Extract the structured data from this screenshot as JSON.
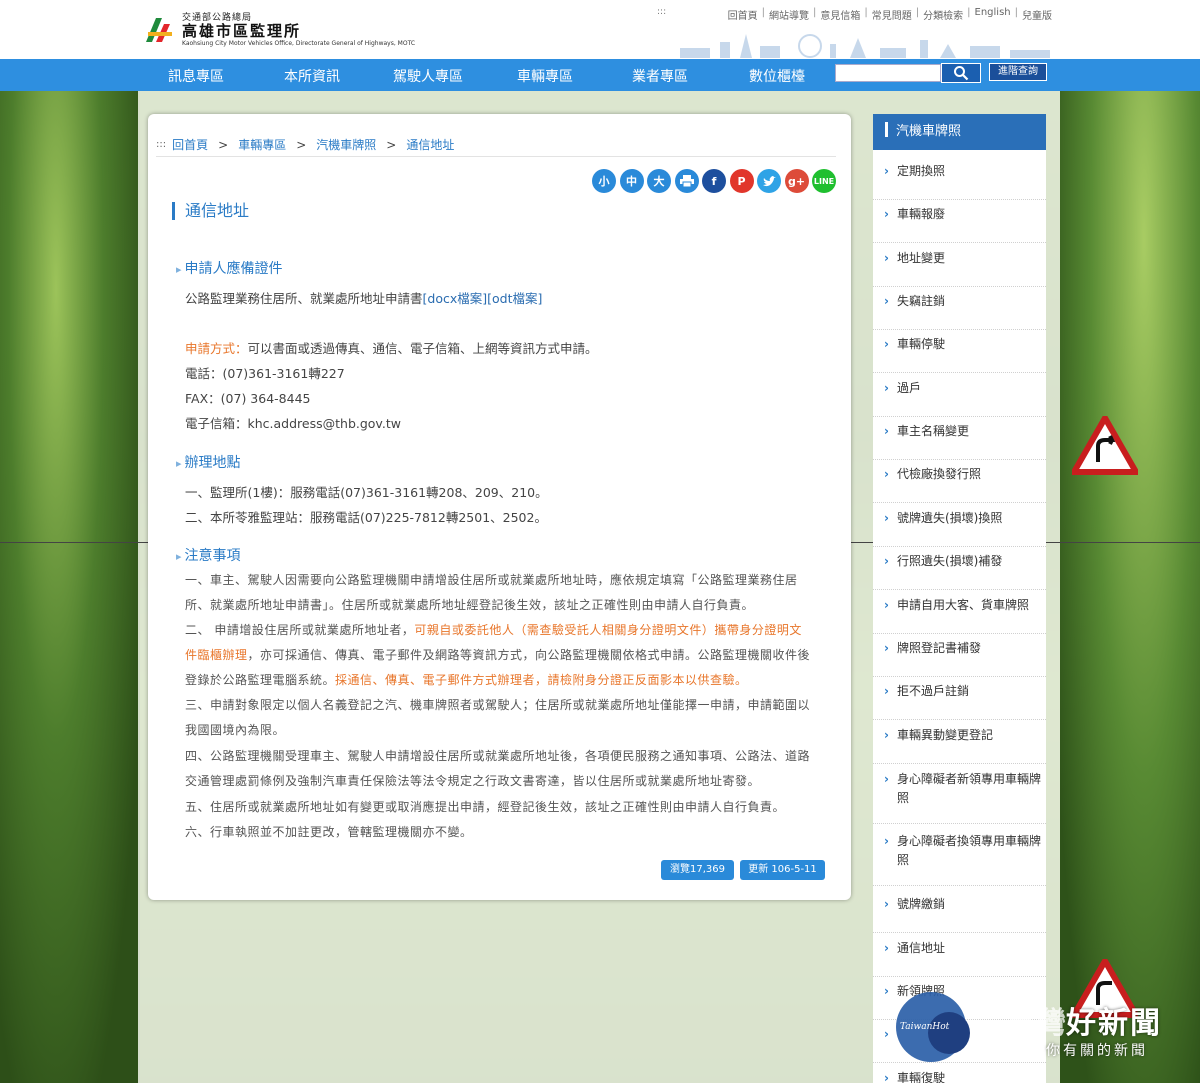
{
  "header": {
    "org_sub": "交通部公路總局",
    "org_main": "高雄市區監理所",
    "org_en": "Kaohsiung City Motor Vehicles Office, Directorate General of Highways, MOTC",
    "top_dots": ":::",
    "top_links": [
      "回首頁",
      "網站導覽",
      "意見信箱",
      "常見問題",
      "分類檢索",
      "English",
      "兒童版"
    ]
  },
  "nav": {
    "items": [
      "訊息專區",
      "本所資訊",
      "駕駛人專區",
      "車輛專區",
      "業者專區",
      "數位櫃檯"
    ],
    "search_placeholder": "",
    "advanced_search": "進階查詢"
  },
  "breadcrumb": {
    "dots": ":::",
    "items": [
      "回首頁",
      "車輛專區",
      "汽機車牌照",
      "通信地址"
    ]
  },
  "share": {
    "font_small": "小",
    "font_medium": "中",
    "font_large": "大",
    "facebook": "f",
    "plurk": "P",
    "googleplus": "g+",
    "line": "LINE"
  },
  "content": {
    "title": "通信地址",
    "s1_title": "申請人應備證件",
    "s1_doc": "公路監理業務住居所、就業處所地址申請書",
    "s1_docx": "[docx檔案]",
    "s1_odt": "[odt檔案]",
    "apply_label": "申請方式：",
    "apply_text": "可以書面或透過傳真、通信、電子信箱、上網等資訊方式申請。",
    "phone": "電話：(07)361-3161轉227",
    "fax": "FAX：(07) 364-8445",
    "email": "電子信箱：khc.address@thb.gov.tw",
    "s2_title": "辦理地點",
    "loc1": "一、監理所(1樓)：服務電話(07)361-3161轉208、209、210。",
    "loc2": "二、本所苓雅監理站：服務電話(07)225-7812轉2501、2502。",
    "s3_title": "注意事項",
    "n1": "一、車主、駕駛人因需要向公路監理機關申請增設住居所或就業處所地址時，應依規定填寫「公路監理業務住居所、就業處所地址申請書」。住居所或就業處所地址經登記後生效，該址之正確性則由申請人自行負責。",
    "n2a": "二、 申請增設住居所或就業處所地址者，",
    "n2b": "可親自或委託他人（需查驗受託人相關身分證明文件）攜帶身分證明文件臨櫃辦理",
    "n2c": "，亦可採通信、傳真、電子郵件及網路等資訊方式，向公路監理機關依格式申請。公路監理機關收件後登錄於公路監理電腦系統。",
    "n2d": "採通信、傳真、電子郵件方式辦理者，請檢附身分證正反面影本以供查驗。",
    "n3": "三、申請對象限定以個人名義登記之汽、機車牌照者或駕駛人；住居所或就業處所地址僅能擇一申請，申請範圍以我國國境內為限。",
    "n4": "四、公路監理機關受理車主、駕駛人申請增設住居所或就業處所地址後，各項便民服務之通知事項、公路法、道路交通管理處罰條例及強制汽車責任保險法等法令規定之行政文書寄達，皆以住居所或就業處所地址寄發。",
    "n5": "五、住居所或就業處所地址如有變更或取消應提出申請，經登記後生效，該址之正確性則由申請人自行負責。",
    "n6": "六、行車執照並不加註更改，管轄監理機關亦不變。",
    "views": "瀏覽17,369",
    "updated": "更新 106-5-11"
  },
  "sidebar": {
    "title": "汽機車牌照",
    "items": [
      "定期換照",
      "車輛報廢",
      "地址變更",
      "失竊註銷",
      "車輛停駛",
      "過戶",
      "車主名稱變更",
      "代檢廠換發行照",
      "號牌遺失(損壞)換照",
      "行照遺失(損壞)補發",
      "申請自用大客、貨車牌照",
      "牌照登記書補發",
      "拒不過戶註銷",
      "車輛異動變更登記",
      "身心障礙者新領專用車輛牌照",
      "身心障礙者換領專用車輛牌照",
      "號牌繳銷",
      "通信地址",
      "新領牌照",
      "",
      "車輛復駛"
    ]
  },
  "watermark": {
    "circle_text": "TaiwanHot",
    "pre": "臺灣",
    "big": "好新聞",
    "small": "你有關的新聞"
  },
  "colors": {
    "nav_blue": "#2e8fe0",
    "link_blue": "#2a7bc6",
    "highlight_orange": "#e8762b",
    "sidebar_head": "#2a6fb8"
  }
}
